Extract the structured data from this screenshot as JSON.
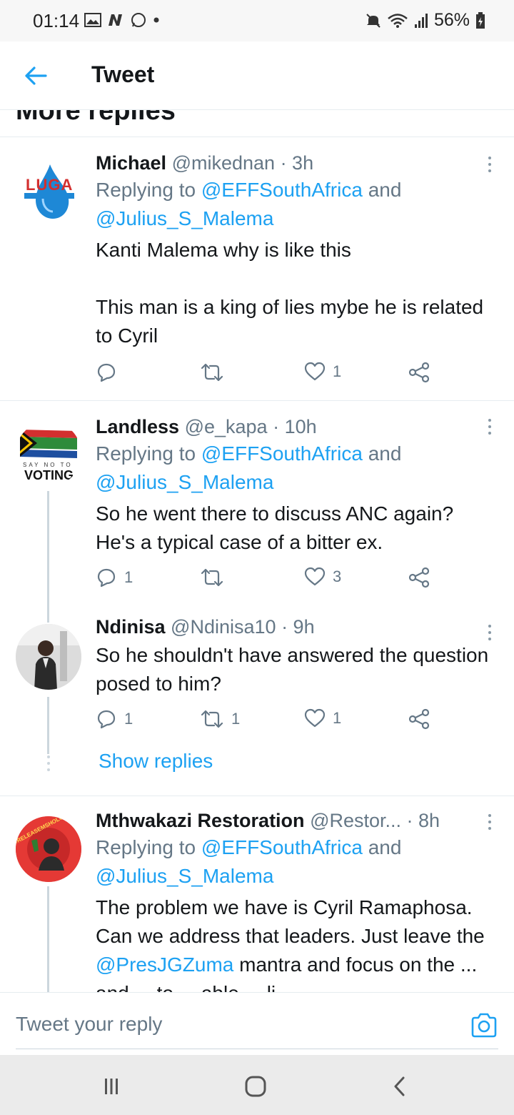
{
  "status_bar": {
    "time": "01:14",
    "battery": "56%",
    "left_icons": [
      "gallery-icon",
      "n-icon",
      "whatsapp-icon",
      "dot"
    ],
    "right_icons": [
      "mute-icon",
      "wifi-icon",
      "signal-icon",
      "battery-icon"
    ]
  },
  "app_bar": {
    "title": "Tweet"
  },
  "section_header": "More replies",
  "tweets": [
    {
      "name": "Michael",
      "handle": "@mikednan",
      "time": "· 3h",
      "reply_prefix": "Replying to ",
      "reply_to_1": "@EFFSouthAfrica",
      "reply_and": " and",
      "reply_to_2": "@Julius_S_Malema",
      "body_1": "Kanti Malema why is like this",
      "body_2": "This man is a king of lies mybe he is related to Cyril",
      "replies": "",
      "retweets": "",
      "likes": "1"
    },
    {
      "name": "Landless",
      "handle": "@e_kapa",
      "time": "· 10h",
      "reply_prefix": "Replying to ",
      "reply_to_1": "@EFFSouthAfrica",
      "reply_and": " and",
      "reply_to_2": "@Julius_S_Malema",
      "body_1": "So he went there to discuss ANC again? He's a typical case of a bitter ex.",
      "replies": "1",
      "retweets": "",
      "likes": "3"
    },
    {
      "name": "Ndinisa",
      "handle": "@Ndinisa10",
      "time": "· 9h",
      "body_1": "So he shouldn't have answered the question posed to him?",
      "replies": "1",
      "retweets": "1",
      "likes": "1",
      "show_replies": "Show replies"
    },
    {
      "name": "Mthwakazi Restoration",
      "handle": "@Restor...",
      "time": "· 8h",
      "reply_prefix": "Replying to ",
      "reply_to_1": "@EFFSouthAfrica",
      "reply_and": " and",
      "reply_to_2": "@Julius_S_Malema",
      "body_1": "The problem we have is Cyril Ramaphosa. Can we address that leaders. Just leave the ",
      "body_mention": "@PresJGZuma",
      "body_2": " mantra and focus on the ... and ... to ... able ... li..."
    }
  ],
  "avatar_texts": {
    "luga": "LUGA",
    "say_no_to": "SAY NO TO",
    "voting": "VOTING",
    "release": "#RELEASEMSHOLOZIKAW"
  },
  "compose": {
    "placeholder": "Tweet your reply"
  },
  "colors": {
    "accent": "#1da1f2",
    "text": "#14171a",
    "secondary": "#657786",
    "divider": "#e6ecf0"
  }
}
